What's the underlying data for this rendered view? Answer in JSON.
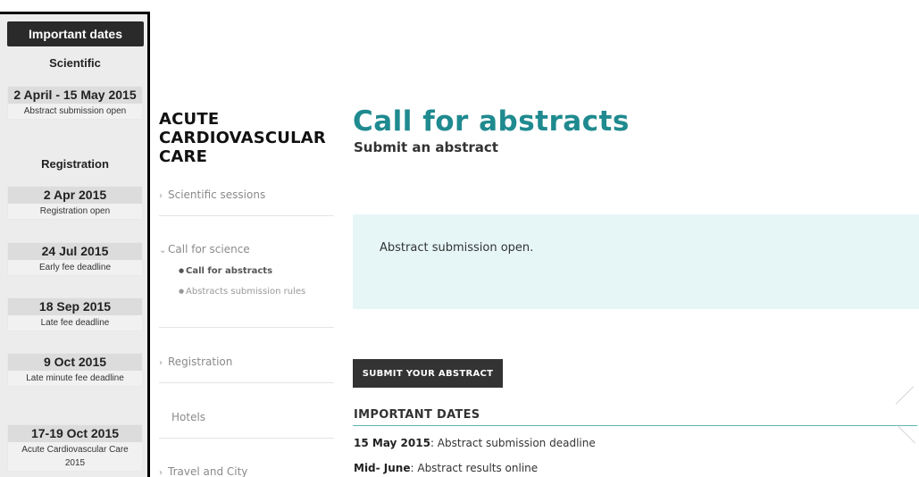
{
  "sidebar_dates": {
    "header": "Important dates",
    "scientific": {
      "title": "Scientific",
      "items": [
        {
          "date": "2 April - 15 May 2015",
          "label": "Abstract submission open"
        }
      ]
    },
    "registration": {
      "title": "Registration",
      "items": [
        {
          "date": "2 Apr 2015",
          "label": "Registration open"
        },
        {
          "date": "24 Jul 2015",
          "label": "Early fee deadline"
        },
        {
          "date": "18 Sep 2015",
          "label": "Late fee deadline"
        },
        {
          "date": "9 Oct 2015",
          "label": "Late minute fee deadline"
        }
      ]
    },
    "event": {
      "date": "17-19 Oct 2015",
      "label_line1": "Acute Cardiovascular Care",
      "label_line2": "2015"
    }
  },
  "site": {
    "title_line1": "ACUTE",
    "title_line2": "CARDIOVASCULAR",
    "title_line3": "CARE"
  },
  "nav": {
    "items": [
      {
        "label": "Scientific sessions"
      },
      {
        "label": "Call for science"
      },
      {
        "label": "Registration"
      },
      {
        "label": "Hotels"
      },
      {
        "label": "Travel and City"
      }
    ],
    "sub_items": [
      {
        "label": "Call for abstracts"
      },
      {
        "label": "Abstracts submission rules"
      }
    ]
  },
  "main": {
    "title": "Call for abstracts",
    "subtitle": "Submit an abstract",
    "notice": "Abstract submission open.",
    "submit_label": "SUBMIT YOUR ABSTRACT",
    "section_heading": "IMPORTANT DATES",
    "dates": [
      {
        "key": "15 May 2015",
        "value": ": Abstract submission deadline"
      },
      {
        "key": "Mid- June",
        "value": ": Abstract results online"
      }
    ]
  },
  "icons": {
    "chevron_right": "chevron-right-icon",
    "chevron_down": "chevron-down-icon"
  },
  "colors": {
    "accent": "#1f8a8f",
    "notice_bg": "#e6f6f7",
    "button_bg": "#333333",
    "panel_header": "#2a2a2a"
  }
}
